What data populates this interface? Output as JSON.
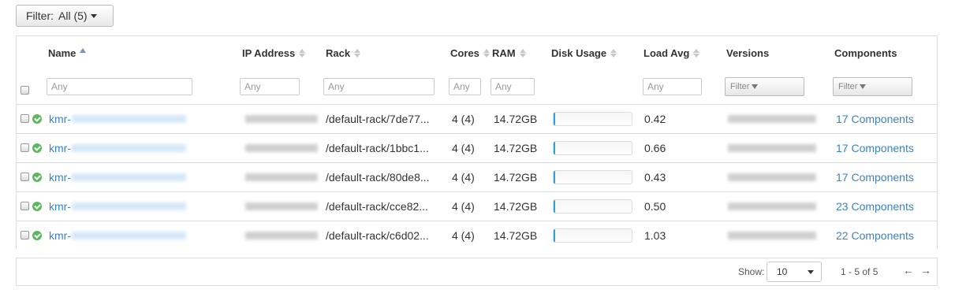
{
  "filter": {
    "label": "Filter:",
    "value": "All (5)"
  },
  "columns": {
    "name": "Name",
    "ip": "IP Address",
    "rack": "Rack",
    "cores": "Cores",
    "ram": "RAM",
    "disk": "Disk Usage",
    "load": "Load Avg",
    "versions": "Versions",
    "components": "Components"
  },
  "filters": {
    "name_placeholder": "Any",
    "ip_placeholder": "Any",
    "rack_placeholder": "Any",
    "cores_placeholder": "Any",
    "ram_placeholder": "Any",
    "load_placeholder": "Any",
    "versions_button": "Filter",
    "components_button": "Filter"
  },
  "rows": [
    {
      "name": "kmr-",
      "rack": "/default-rack/7de77...",
      "cores": "4 (4)",
      "ram": "14.72GB",
      "disk_usage": 0.02,
      "load": "0.42",
      "components": "17 Components"
    },
    {
      "name": "kmr-",
      "rack": "/default-rack/1bbc1...",
      "cores": "4 (4)",
      "ram": "14.72GB",
      "disk_usage": 0.02,
      "load": "0.66",
      "components": "17 Components"
    },
    {
      "name": "kmr-",
      "rack": "/default-rack/80de8...",
      "cores": "4 (4)",
      "ram": "14.72GB",
      "disk_usage": 0.02,
      "load": "0.43",
      "components": "17 Components"
    },
    {
      "name": "kmr-",
      "rack": "/default-rack/cce82...",
      "cores": "4 (4)",
      "ram": "14.72GB",
      "disk_usage": 0.02,
      "load": "0.50",
      "components": "23 Components"
    },
    {
      "name": "kmr-",
      "rack": "/default-rack/c6d02...",
      "cores": "4 (4)",
      "ram": "14.72GB",
      "disk_usage": 0.02,
      "load": "1.03",
      "components": "22 Components"
    }
  ],
  "footer": {
    "show_label": "Show:",
    "page_size": "10",
    "range": "1 - 5 of 5"
  },
  "colors": {
    "link": "#3a83c5",
    "healthy": "#5cb85c",
    "disk_fill": "#2e9fd8"
  }
}
